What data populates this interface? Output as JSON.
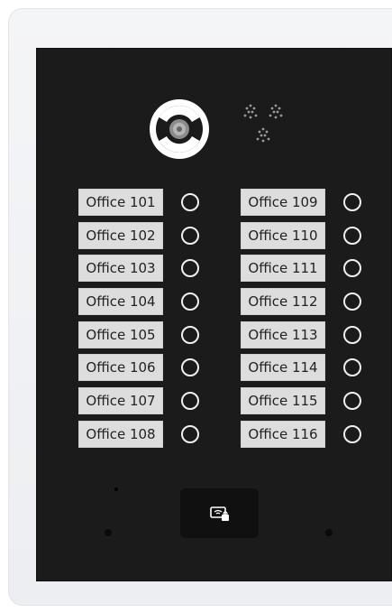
{
  "panel": {
    "left_column": [
      "Office 101",
      "Office 102",
      "Office 103",
      "Office 104",
      "Office 105",
      "Office 106",
      "Office 107",
      "Office 108"
    ],
    "right_column": [
      "Office 109",
      "Office 110",
      "Office 111",
      "Office 112",
      "Office 113",
      "Office 114",
      "Office 115",
      "Office 116"
    ]
  },
  "icons": {
    "camera": "camera-icon",
    "speaker": "speaker-icon",
    "call_button": "call-button-icon",
    "card_reader": "card-reader-icon",
    "microphone": "microphone-icon"
  },
  "colors": {
    "panel": "#1b1b1b",
    "frame": "#f0f1f3",
    "label_bg": "#dddddd",
    "label_text": "#222222",
    "button_ring": "#f0f0f0",
    "reader_bg": "#101010"
  }
}
